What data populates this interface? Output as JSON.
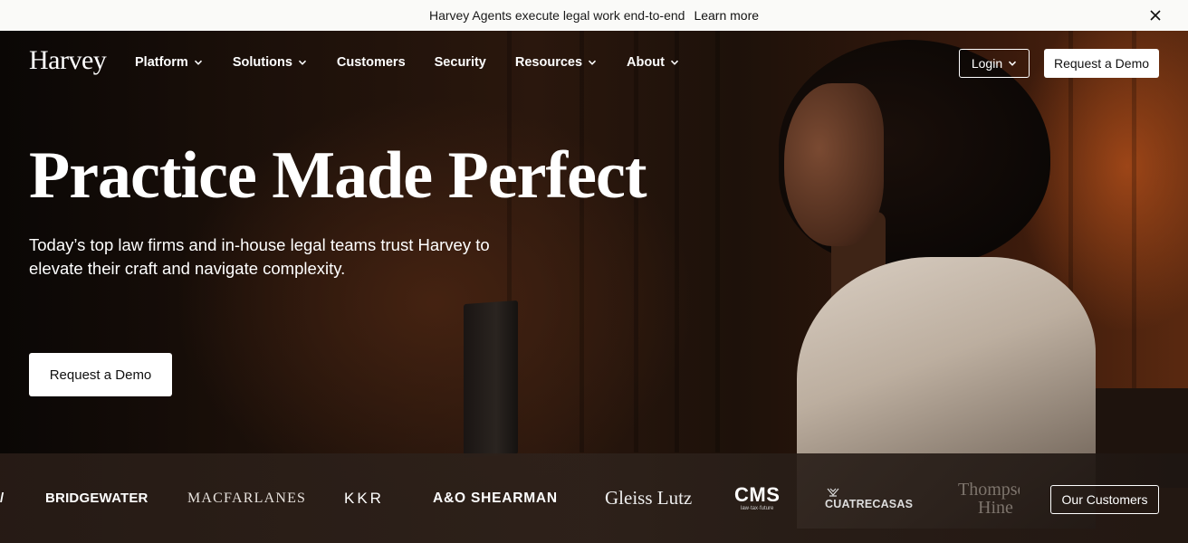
{
  "announcement": {
    "message": "Harvey Agents execute legal work end-to-end",
    "link_label": "Learn more"
  },
  "header": {
    "logo": "Harvey",
    "nav": [
      {
        "label": "Platform",
        "has_dropdown": true
      },
      {
        "label": "Solutions",
        "has_dropdown": true
      },
      {
        "label": "Customers",
        "has_dropdown": false
      },
      {
        "label": "Security",
        "has_dropdown": false
      },
      {
        "label": "Resources",
        "has_dropdown": true
      },
      {
        "label": "About",
        "has_dropdown": true
      }
    ],
    "login_label": "Login",
    "demo_label": "Request a Demo"
  },
  "hero": {
    "headline": "Practice Made Perfect",
    "subheadline": "Today’s top law firms and in-house legal teams trust Harvey to elevate their craft and navigate complexity.",
    "cta_label": "Request a Demo"
  },
  "customers": {
    "logos": {
      "bridgewater": "BRIDGEWATER",
      "macfarlanes": "MACFARLANES",
      "kkr": "KKR",
      "ao_shearman": "A&O SHEARMAN",
      "gleiss_lutz": "Gleiss Lutz",
      "cms": "CMS",
      "cms_tagline": "law·tax·future",
      "cuatrecasas": "CUATRECASAS",
      "thompson_line1": "Thompson",
      "thompson_line2": "Hine"
    },
    "button_label": "Our Customers"
  },
  "colors": {
    "announcement_bg": "#fafaf8",
    "hero_dark": "#0d0907",
    "accent_copper": "#5a2910",
    "button_bg": "#ffffff"
  }
}
